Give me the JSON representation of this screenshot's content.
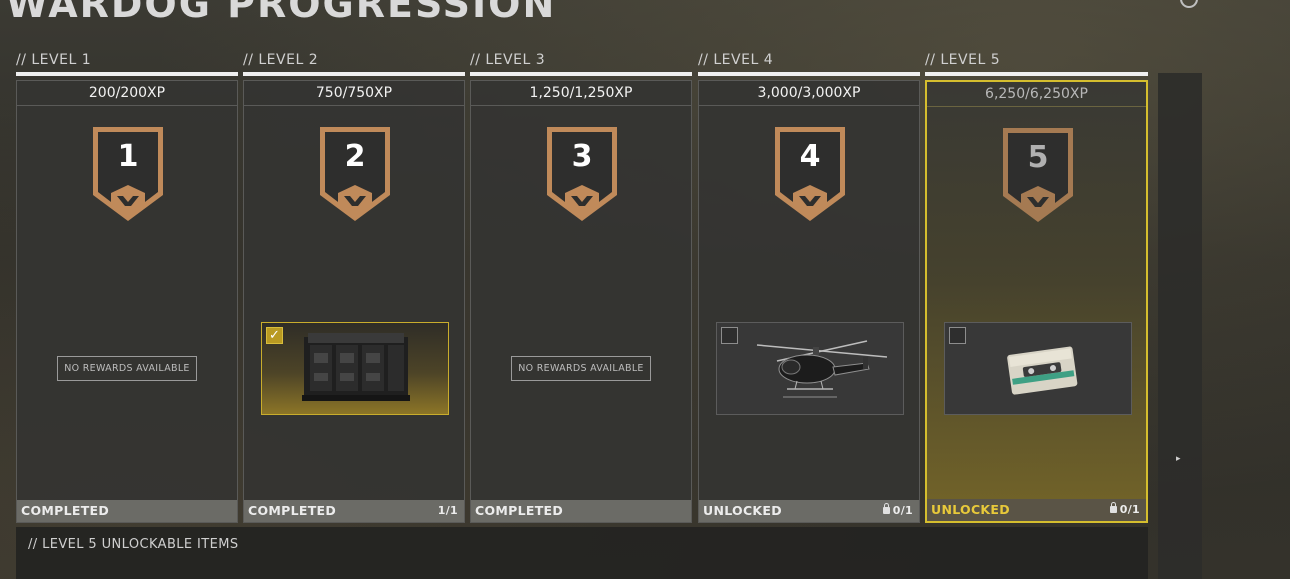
{
  "page": {
    "title": "WARDOG PROGRESSION"
  },
  "levels": [
    {
      "header": "// LEVEL 1",
      "xp": "200/200XP",
      "number": "1",
      "reward": "NO REWARDS AVAILABLE",
      "status": "COMPLETED",
      "count": ""
    },
    {
      "header": "// LEVEL 2",
      "xp": "750/750XP",
      "number": "2",
      "reward": "crate",
      "status": "COMPLETED",
      "count": "1/1"
    },
    {
      "header": "// LEVEL 3",
      "xp": "1,250/1,250XP",
      "number": "3",
      "reward": "NO REWARDS AVAILABLE",
      "status": "COMPLETED",
      "count": ""
    },
    {
      "header": "// LEVEL 4",
      "xp": "3,000/3,000XP",
      "number": "4",
      "reward": "helicopter",
      "status": "UNLOCKED",
      "count": "0/1"
    },
    {
      "header": "// LEVEL 5",
      "xp": "6,250/6,250XP",
      "number": "5",
      "reward": "cassette",
      "status": "UNLOCKED",
      "count": "0/1"
    }
  ],
  "bottom": {
    "title": "// LEVEL 5 UNLOCKABLE ITEMS"
  },
  "icons": {
    "badge": "wardog-emblem-icon",
    "check": "check-icon",
    "lock": "lock-icon",
    "next": "chevron-right-icon"
  },
  "colors": {
    "accent_gold": "#d5be2e",
    "badge_bronze": "#c08a5a",
    "status_bar": "#6b6b66"
  }
}
